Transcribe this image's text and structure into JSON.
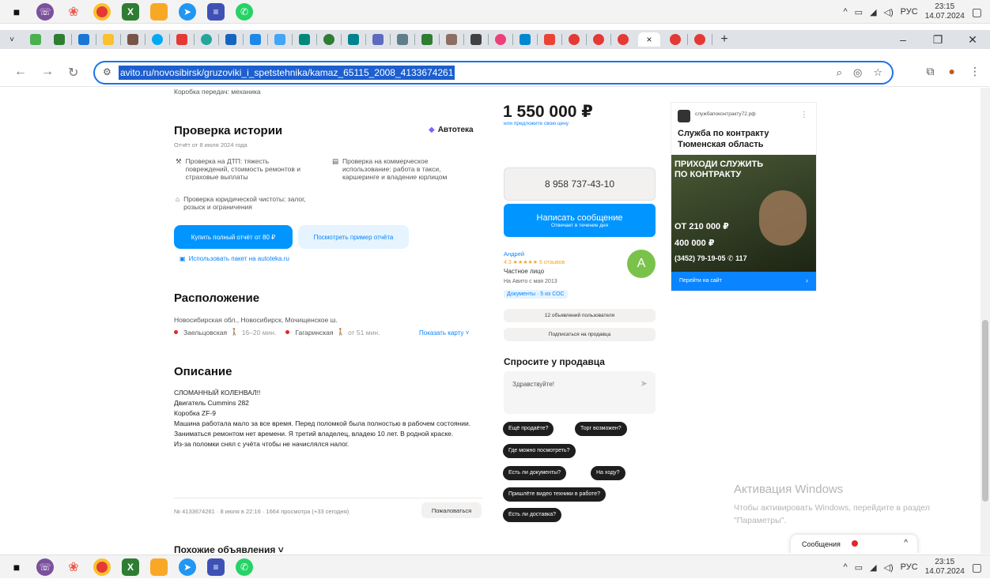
{
  "colors": {
    "accent": "#0095ff",
    "omnibox_border": "#1a73e8",
    "metro_red": "#e4252b",
    "avatar": "#7ac34a"
  },
  "taskbar": {
    "icons": [
      "viber-icon",
      "paint-icon",
      "chrome-icon",
      "excel-icon",
      "explorer-icon",
      "telegram-icon",
      "notepad-icon",
      "whatsapp-icon"
    ],
    "tray_lang": "РУС",
    "time": "23:15",
    "date": "14.07.2024"
  },
  "browser": {
    "url": "avito.ru/novosibirsk/gruzoviki_i_spetstehnika/kamaz_65115_2008_4133674261",
    "new_tab": "+"
  },
  "listing": {
    "top_cut_text": "Коробка передач: механика",
    "history": {
      "title": "Проверка истории",
      "subtitle": "Отчёт от 8 июля 2024 года",
      "brand": "Автотека",
      "item1": "Проверка на ДТП: тяжесть повреждений, стоимость ремонтов и страховые выплаты",
      "item2": "Проверка на коммерческое использование: работа в такси, каршеринге и владение юрлицом",
      "item3": "Проверка юридической чистоты: залог, розыск и ограничения",
      "buy_button": "Купить полный отчёт от 80 ₽",
      "sample_button": "Посмотреть пример отчёта",
      "package_link": "Использовать пакет на autoteka.ru"
    },
    "location": {
      "title": "Расположение",
      "address": "Новосибирская обл., Новосибирск, Мочищенское ш.",
      "metro1": "Заельцовская",
      "metro1_time": "16–20 мин.",
      "metro2": "Гагаринская",
      "metro2_time": "от 51 мин.",
      "show_map": "Показать карту ˅"
    },
    "description": {
      "title": "Описание",
      "line1": "СЛОМАННЫЙ КОЛЕНВАЛ!!",
      "line2": "Двигатель Cummins 282",
      "line3": "Коробка ZF-9",
      "line4": "Машина работала мало за все время. Перед поломкой была полностью в рабочем состоянии. Заниматься ремонтом нет времени. Я третий владелец, владею 10 лет. В родной краске.",
      "line5": "Из-за поломки снял с учёта чтобы не начислялся налог."
    },
    "meta": "№ 4133674261 · 8 июля в 22:16 · 1664 просмотра (+33 сегодня)",
    "complain": "Пожаловаться",
    "similar": "Похожие объявления ˅"
  },
  "sidebar": {
    "price": "1 550 000 ₽",
    "price_link": "или предложите свою цену",
    "phone": "8 958 737-43-10",
    "write": "Написать сообщение",
    "write_sub": "Отвечает в течение дня",
    "seller_name": "Андрей",
    "rating": "4.3 ★★★★★ 6 отзывов",
    "seller_type": "Частное лицо",
    "since": "На Авито с мая 2013",
    "docs": "Документы · 5 из СОС",
    "ads_count": "12 объявлений пользователя",
    "subscribe": "Подписаться на продавца",
    "ask_title": "Спросите у продавца",
    "ask_placeholder": "Здравствуйте!",
    "avatar_letter": "А",
    "q1": "Ещё продаёте?",
    "q2": "Торг возможен?",
    "q3": "Где можно посмотреть?",
    "q4": "Есть ли документы?",
    "q5": "На ходу?",
    "q6": "Пришлёте видео техники в работе?",
    "q7": "Есть ли доставка?"
  },
  "ad": {
    "domain": "службапоконтракту72.рф",
    "title1": "Служба по контракту",
    "title2": "Тюменская область",
    "banner_top": "ПРИХОДИ СЛУЖИТЬ ПО КОНТРАКТУ",
    "banner_amount1": "ОТ 210 000 ₽",
    "banner_amount2": "400 000 ₽",
    "banner_phone": "(3452) 79-19-05  ✆ 117",
    "cta": "Перейти на сайт"
  },
  "windows": {
    "activate_title": "Активация Windows",
    "activate_text": "Чтобы активировать Windows, перейдите в раздел \"Параметры\"."
  },
  "messages_widget": "Сообщения"
}
